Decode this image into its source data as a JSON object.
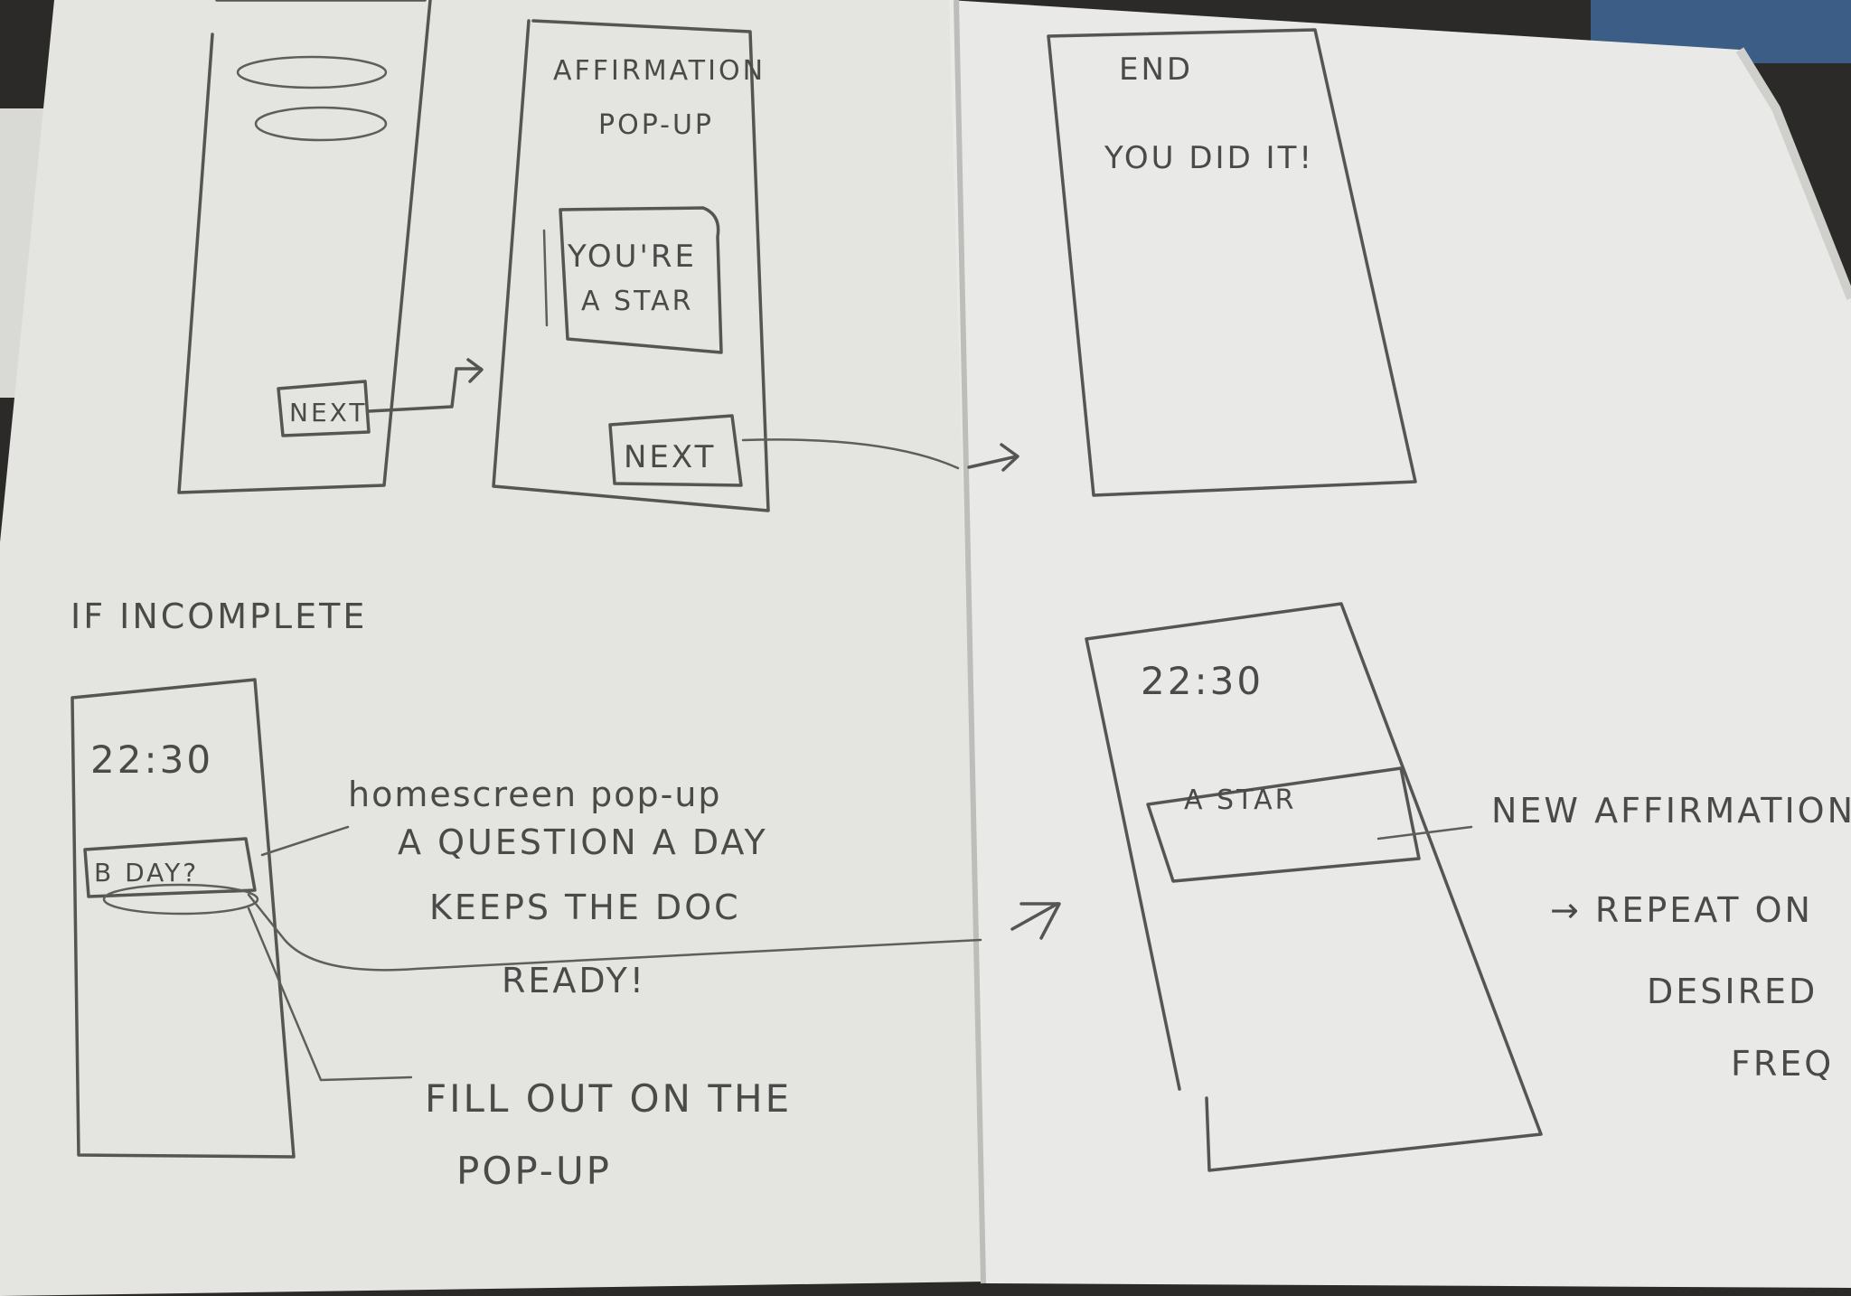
{
  "frames": {
    "affirmation": {
      "title_line1": "AFFIRMATION",
      "title_line2": "POP-UP",
      "card_line1": "YOU'RE",
      "card_line2": "A STAR"
    },
    "end": {
      "title": "END",
      "message": "YOU DID IT!"
    },
    "first": {
      "button": "NEXT"
    },
    "affirmation_next": {
      "button": "NEXT"
    },
    "incomplete_home": {
      "time": "22:30",
      "popup": "B DAY?"
    },
    "new_affirmation_home": {
      "time": "22:30",
      "popup": "A STAR"
    }
  },
  "notes": {
    "if_incomplete": "IF INCOMPLETE",
    "homescreen": {
      "line1": "homescreen pop-up",
      "line2": "A QUESTION A DAY",
      "line3": "KEEPS THE DOC",
      "line4": "READY!"
    },
    "fill_out": {
      "line1": "FILL OUT ON THE",
      "line2": "POP-UP"
    },
    "new_affirmation": {
      "line1": "NEW AFFIRMATION",
      "line2": "→ REPEAT ON",
      "line3": "DESIRED",
      "line4": "FREQ"
    }
  },
  "colors": {
    "paper": "#e6e6e3",
    "ink": "#555553",
    "background": "#2b2a28"
  }
}
